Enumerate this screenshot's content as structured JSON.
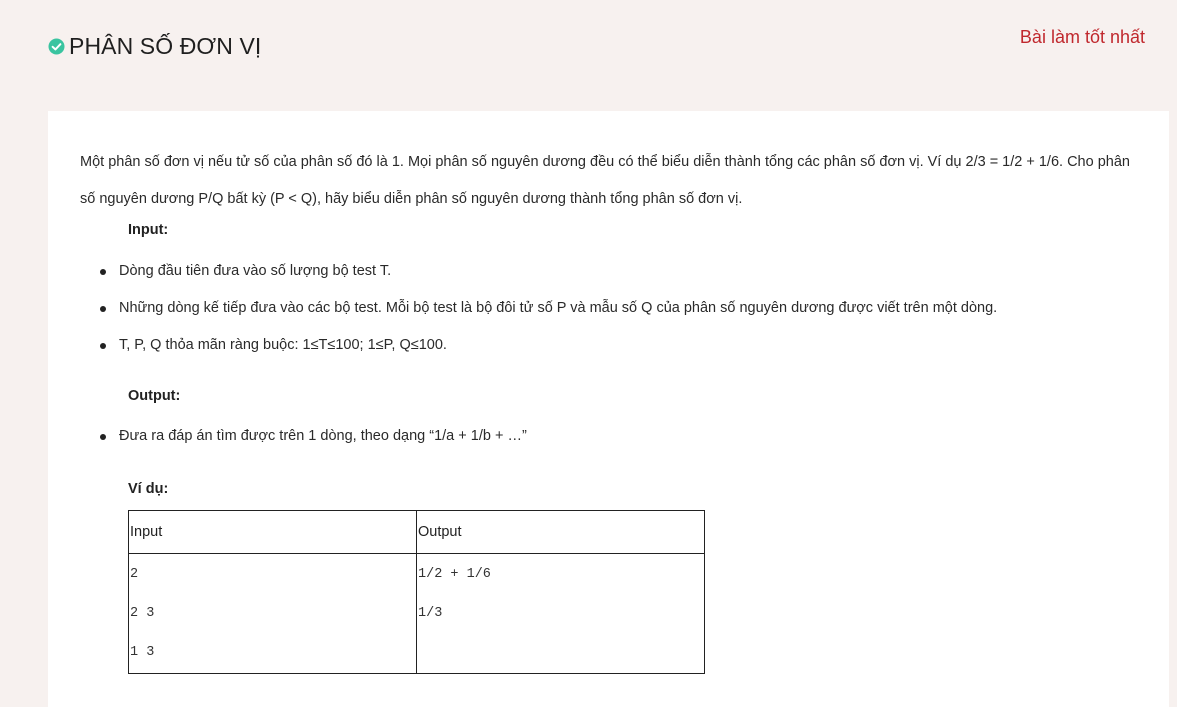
{
  "header": {
    "title": "PHÂN SỐ ĐƠN VỊ",
    "status_icon": "check-circle-icon",
    "status_color": "#3ac4a0",
    "best_link": "Bài làm tốt nhất",
    "best_link_color": "#c0282d"
  },
  "problem": {
    "description": "Một phân số đơn vị nếu tử số của phân số đó là 1. Mọi phân số nguyên dương đều có thể biểu diễn thành tổng các phân số đơn vị. Ví dụ 2/3 = 1/2  + 1/6. Cho phân số nguyên dương P/Q bất kỳ (P < Q), hãy biểu diễn phân số nguyên dương thành tổng phân số đơn vị.",
    "input_label": "Input:",
    "input_items": [
      "Dòng đầu tiên đưa vào số lượng bộ test T.",
      "Những dòng kế tiếp đưa vào các bộ test. Mỗi bộ test là bộ đôi tử số P và mẫu số Q của phân số nguyên dương được viết trên một dòng.",
      "T, P, Q thỏa mãn ràng buộc: 1≤T≤100;  1≤P, Q≤100."
    ],
    "output_label": "Output:",
    "output_items": [
      "Đưa ra đáp án tìm được trên 1 dòng, theo dạng “1/a + 1/b + …”"
    ],
    "example_label": "Ví dụ:",
    "example": {
      "headers": [
        "Input",
        "Output"
      ],
      "input_lines": [
        "2",
        "2 3",
        "1 3"
      ],
      "output_lines": [
        "1/2 + 1/6",
        "1/3"
      ]
    }
  }
}
